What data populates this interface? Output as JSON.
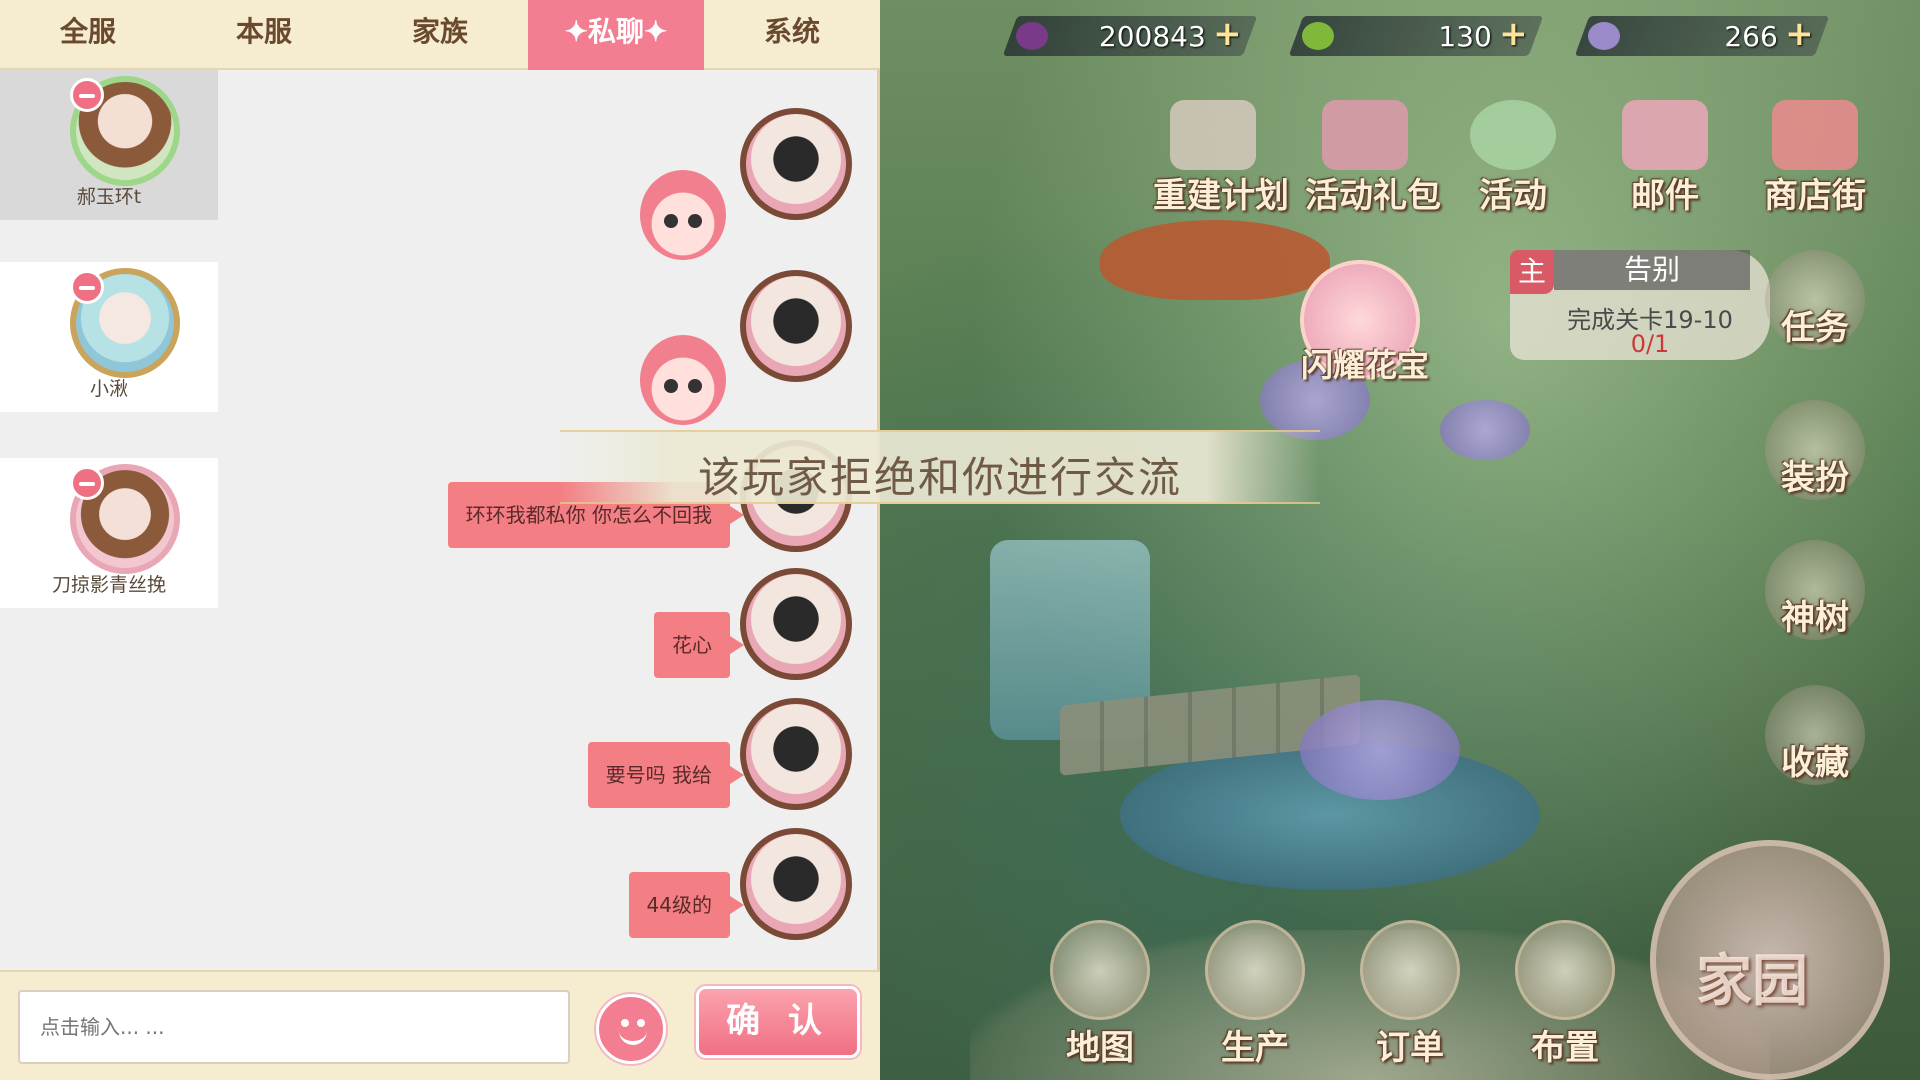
{
  "tabs": [
    {
      "label": "全服"
    },
    {
      "label": "本服"
    },
    {
      "label": "家族"
    },
    {
      "label": "✦私聊✦"
    },
    {
      "label": "系统"
    }
  ],
  "friends": [
    {
      "name": "郝玉环t"
    },
    {
      "name": "小湫"
    },
    {
      "name": "刀掠影青丝挽"
    }
  ],
  "messages": [
    {
      "text": "环环我都私你 你怎么不回我"
    },
    {
      "text": "花心"
    },
    {
      "text": "要号吗 我给"
    },
    {
      "text": "44级的"
    }
  ],
  "input": {
    "placeholder": "点击输入... ..."
  },
  "confirm_label": "确 认",
  "toast": "该玩家拒绝和你进行交流",
  "currencies": [
    {
      "value": "200843",
      "icon": "gem-icon"
    },
    {
      "value": "130",
      "icon": "leaf-icon"
    },
    {
      "value": "266",
      "icon": "flower-coin-icon"
    }
  ],
  "top_menu": [
    {
      "label": "重建计划"
    },
    {
      "label": "活动礼包"
    },
    {
      "label": "活动"
    },
    {
      "label": "邮件"
    },
    {
      "label": "商店街"
    }
  ],
  "quest": {
    "tag": "主",
    "title": "告别",
    "desc": "完成关卡19-10",
    "progress": "0/1"
  },
  "side_menu": [
    {
      "label": "任务"
    },
    {
      "label": "装扮"
    },
    {
      "label": "神树"
    },
    {
      "label": "收藏"
    }
  ],
  "hero_name": "闪耀花宝",
  "bottom_menu": [
    {
      "label": "地图"
    },
    {
      "label": "生产"
    },
    {
      "label": "订单"
    },
    {
      "label": "布置"
    }
  ],
  "home_label": "家园",
  "colors": {
    "accent": "#f37e91",
    "bubble": "#f37e84",
    "tabbar": "#f6ecd0"
  }
}
